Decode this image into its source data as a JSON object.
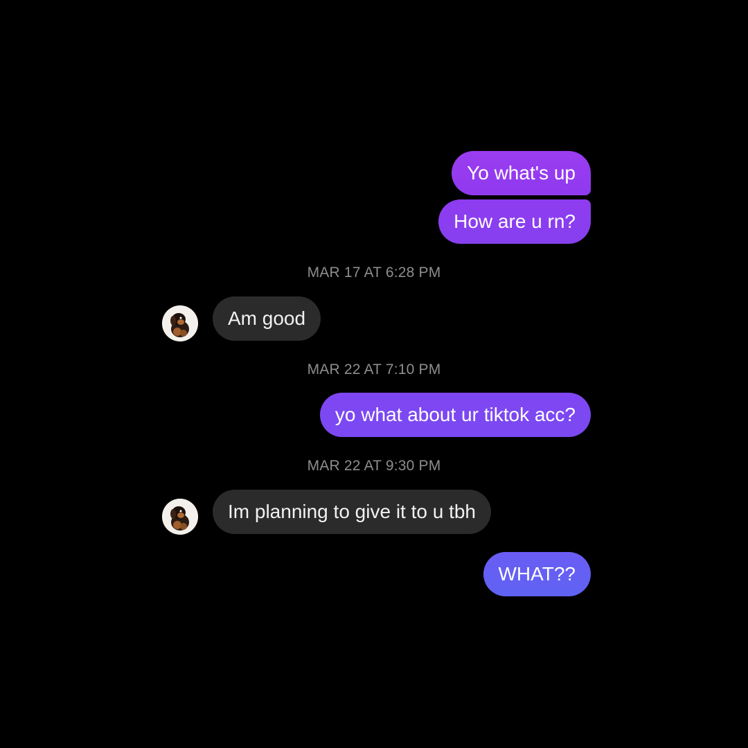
{
  "conversation": {
    "messages": [
      {
        "sender": "me",
        "text": "Yo what's up"
      },
      {
        "sender": "me",
        "text": "How are u rn?"
      },
      {
        "type": "timestamp",
        "text": "MAR 17 AT 6:28 PM"
      },
      {
        "sender": "contact",
        "text": "Am good",
        "avatar_icon": "dog-avatar-icon"
      },
      {
        "type": "timestamp",
        "text": "MAR 22 AT 7:10 PM"
      },
      {
        "sender": "me",
        "text": "yo what about ur tiktok acc?"
      },
      {
        "type": "timestamp",
        "text": "MAR 22 AT 9:30 PM"
      },
      {
        "sender": "contact",
        "text": "Im planning to give it to u tbh",
        "avatar_icon": "dog-avatar-icon"
      },
      {
        "sender": "me",
        "text": "WHAT??"
      }
    ]
  },
  "colors": {
    "background": "#000000",
    "incoming_bubble": "#2b2b2b",
    "outgoing_gradient_top": "#9b3cf0",
    "outgoing_gradient_bottom": "#5f63f4",
    "timestamp": "#8e8e8e"
  }
}
